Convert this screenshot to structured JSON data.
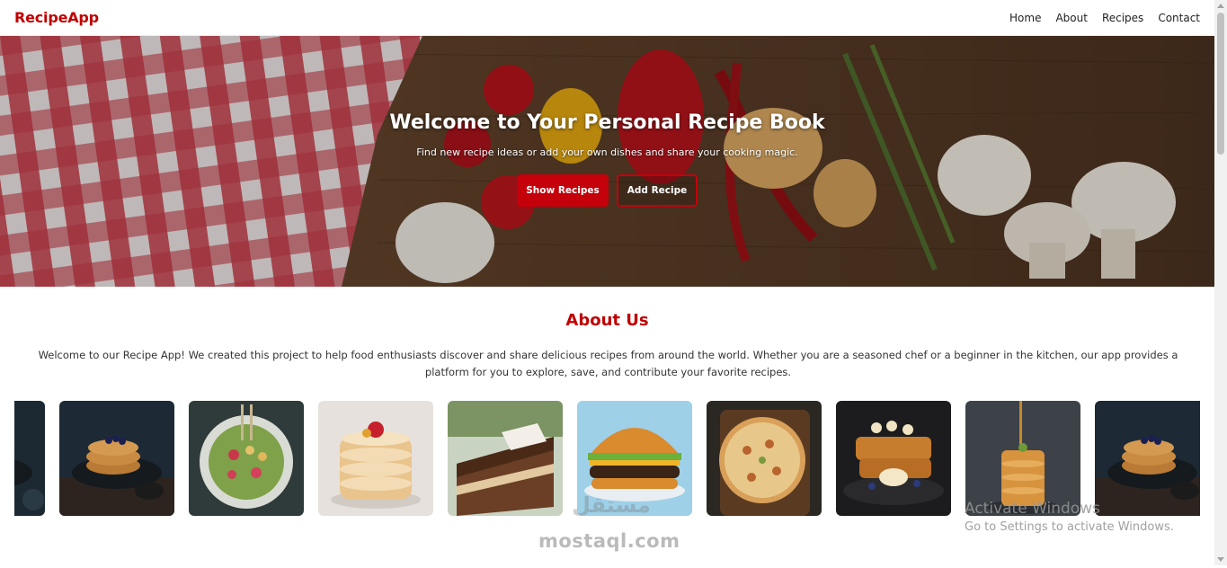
{
  "navbar": {
    "brand": "RecipeApp",
    "links": [
      "Home",
      "About",
      "Recipes",
      "Contact"
    ]
  },
  "hero": {
    "title": "Welcome to Your Personal Recipe Book",
    "subtitle": "Find new recipe ideas or add your own dishes and share your cooking magic.",
    "primary_button": "Show Recipes",
    "secondary_button": "Add Recipe"
  },
  "about": {
    "title": "About Us",
    "text": "Welcome to our Recipe App! We created this project to help food enthusiasts discover and share delicious recipes from around the world. Whether you are a seasoned chef or a beginner in the kitchen, our app provides a platform for you to explore, save, and contribute your favorite recipes."
  },
  "gallery": {
    "images": [
      "pancakes-dark-image",
      "pancakes-dark-image",
      "salad-bowl-image",
      "pancake-stack-image",
      "chocolate-cake-image",
      "burger-image",
      "pizza-image",
      "french-toast-image",
      "syrup-pancakes-image",
      "pancakes-dark-image"
    ]
  },
  "watermark": {
    "logo_text": "مستقل",
    "site": "mostaql.com"
  },
  "os_notice": {
    "title": "Activate Windows",
    "subtitle": "Go to Settings to activate Windows."
  },
  "colors": {
    "brand": "#c00000",
    "button": "#c4000b"
  }
}
